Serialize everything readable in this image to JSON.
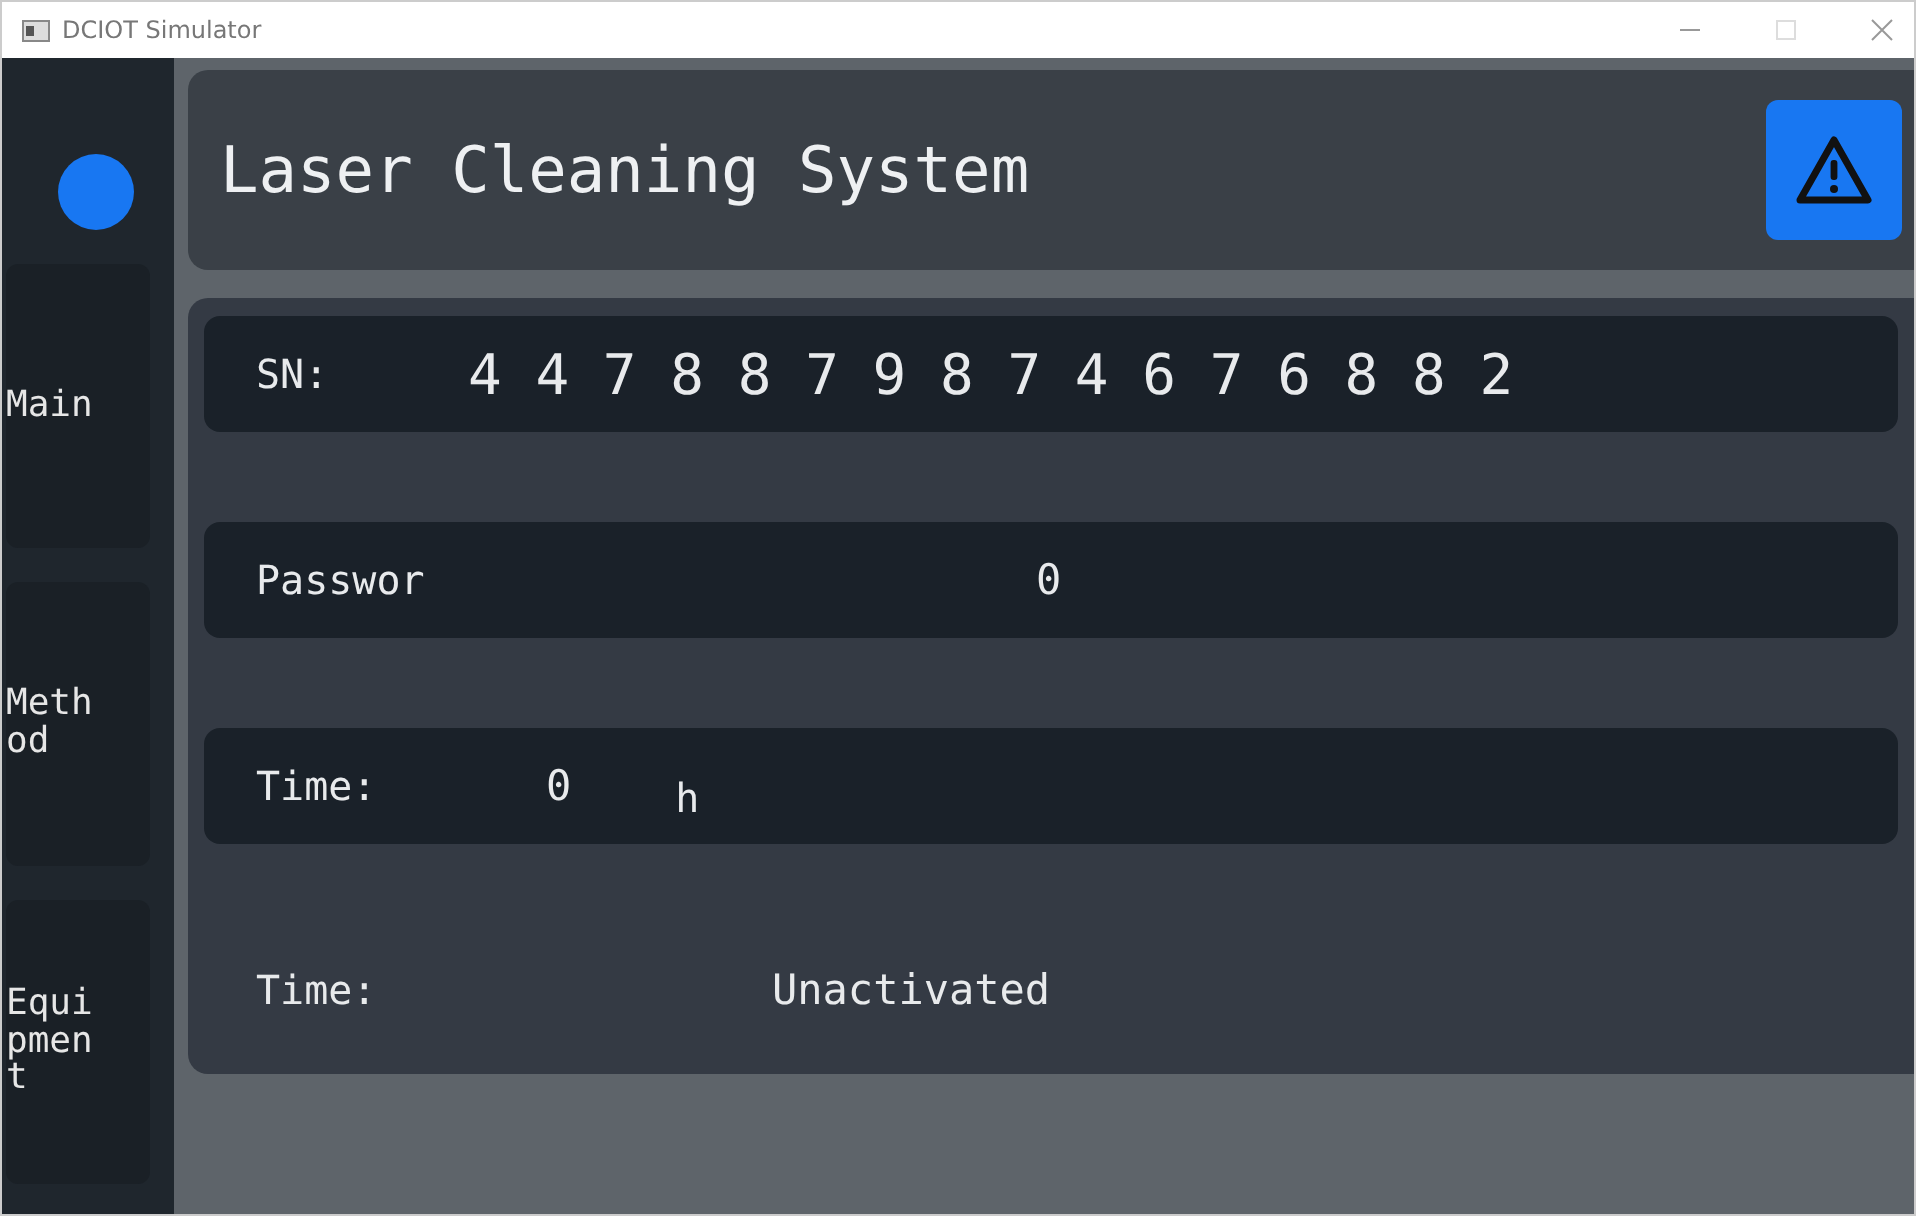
{
  "window": {
    "title": "DCIOT Simulator"
  },
  "sidebar": {
    "items": [
      {
        "label": "Main"
      },
      {
        "label": "Method"
      },
      {
        "label": "Equipment"
      }
    ]
  },
  "header": {
    "title": "Laser Cleaning System"
  },
  "rows": [
    {
      "kind": "field",
      "label": "SN:",
      "value": "4 4 7 8 8 7 9 8 7 4 6 7 6 8 8 2"
    },
    {
      "kind": "field",
      "label": "Passwor",
      "value": "0"
    },
    {
      "kind": "field",
      "label": "Time:",
      "value": "0",
      "unit": "h"
    },
    {
      "kind": "plain",
      "label": "Time:",
      "value": "Unactivated"
    }
  ]
}
